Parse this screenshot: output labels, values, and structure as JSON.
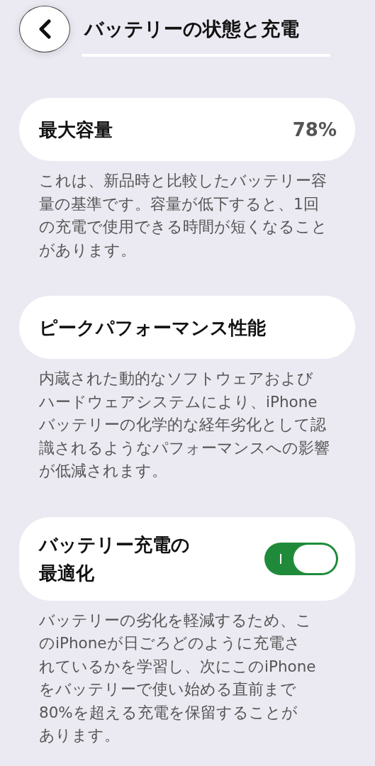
{
  "header": {
    "title": "バッテリーの状態と充電"
  },
  "sections": [
    {
      "kind": "value",
      "label": "最大容量",
      "value": "78%",
      "description": [
        "これは、新品時と比較したバッテリー容",
        "量の基準です。容量が低下すると、1回",
        "の充電で使用できる時間が短くなること",
        "があります。"
      ]
    },
    {
      "kind": "plain",
      "label": "ピークパフォーマンス性能",
      "description": [
        "内蔵された動的なソフトウェアおよび",
        "ハードウェアシステムにより、iPhone",
        "バッテリーの化学的な経年劣化として認",
        "識されるようなパフォーマンスへの影響",
        "が低減されます。"
      ]
    },
    {
      "kind": "toggle",
      "label": "バッテリー充電の最適化",
      "on": true,
      "description": [
        "バッテリーの劣化を軽減するため、こ",
        "のiPhoneが日ごろどのように充電さ",
        "れているかを学習し、次にこのiPhone",
        "をバッテリーで使い始める直前まで",
        "80%を超える充電を保留することが",
        "あります。"
      ]
    }
  ]
}
